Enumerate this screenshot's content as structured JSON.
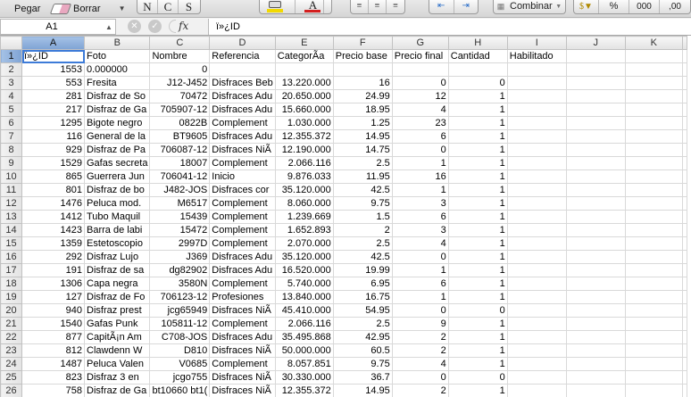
{
  "toolbar": {
    "paste_label": "Pegar",
    "clear_label": "Borrar",
    "bold": "N",
    "italic": "C",
    "underline": "S",
    "merge_label": "Combinar",
    "percent": "%",
    "thousands": "000",
    "decimals": ",00",
    "icon_font_color": "#d42020",
    "icon_fill_color": "#f2d900"
  },
  "formula_bar": {
    "cell_ref": "A1",
    "fx": "fx",
    "content": "ï»¿ID"
  },
  "columns": [
    "A",
    "B",
    "C",
    "D",
    "E",
    "F",
    "G",
    "H",
    "I",
    "J",
    "K"
  ],
  "rows": [
    {
      "n": "1",
      "cells": [
        "ï»¿ID",
        "Foto",
        "Nombre",
        "Referencia",
        "CategorÃ­a",
        "Precio base",
        "Precio final",
        "Cantidad",
        "Habilitado",
        "",
        ""
      ]
    },
    {
      "n": "2",
      "cells": [
        "1553",
        "0.000000",
        "0",
        "",
        "",
        "",
        "",
        "",
        "",
        "",
        ""
      ]
    },
    {
      "n": "3",
      "cells": [
        "553",
        "Fresita",
        "J12-J452",
        "Disfraces Beb",
        "13.220.000",
        "16",
        "0",
        "0",
        "",
        "",
        ""
      ]
    },
    {
      "n": "4",
      "cells": [
        "281",
        "Disfraz de So",
        "70472",
        "Disfraces Adu",
        "20.650.000",
        "24.99",
        "12",
        "1",
        "",
        "",
        ""
      ]
    },
    {
      "n": "5",
      "cells": [
        "217",
        "Disfraz de Ga",
        "705907-12",
        "Disfraces Adu",
        "15.660.000",
        "18.95",
        "4",
        "1",
        "",
        "",
        ""
      ]
    },
    {
      "n": "6",
      "cells": [
        "1295",
        "Bigote negro",
        "0822B",
        "Complement",
        "1.030.000",
        "1.25",
        "23",
        "1",
        "",
        "",
        ""
      ]
    },
    {
      "n": "7",
      "cells": [
        "116",
        "General de la",
        "BT9605",
        "Disfraces Adu",
        "12.355.372",
        "14.95",
        "6",
        "1",
        "",
        "",
        ""
      ]
    },
    {
      "n": "8",
      "cells": [
        "929",
        "Disfraz de Pa",
        "706087-12",
        "Disfraces NiÃ",
        "12.190.000",
        "14.75",
        "0",
        "1",
        "",
        "",
        ""
      ]
    },
    {
      "n": "9",
      "cells": [
        "1529",
        "Gafas secreta",
        "18007",
        "Complement",
        "2.066.116",
        "2.5",
        "1",
        "1",
        "",
        "",
        ""
      ]
    },
    {
      "n": "10",
      "cells": [
        "865",
        "Guerrera Jun",
        "706041-12",
        "Inicio",
        "9.876.033",
        "11.95",
        "16",
        "1",
        "",
        "",
        ""
      ]
    },
    {
      "n": "11",
      "cells": [
        "801",
        "Disfraz de bo",
        "J482-JOS",
        "Disfraces cor",
        "35.120.000",
        "42.5",
        "1",
        "1",
        "",
        "",
        ""
      ]
    },
    {
      "n": "12",
      "cells": [
        "1476",
        "Peluca mod.",
        "M6517",
        "Complement",
        "8.060.000",
        "9.75",
        "3",
        "1",
        "",
        "",
        ""
      ]
    },
    {
      "n": "13",
      "cells": [
        "1412",
        "Tubo Maquil",
        "15439",
        "Complement",
        "1.239.669",
        "1.5",
        "6",
        "1",
        "",
        "",
        ""
      ]
    },
    {
      "n": "14",
      "cells": [
        "1423",
        "Barra de labi",
        "15472",
        "Complement",
        "1.652.893",
        "2",
        "3",
        "1",
        "",
        "",
        ""
      ]
    },
    {
      "n": "15",
      "cells": [
        "1359",
        "Estetoscopio",
        "2997D",
        "Complement",
        "2.070.000",
        "2.5",
        "4",
        "1",
        "",
        "",
        ""
      ]
    },
    {
      "n": "16",
      "cells": [
        "292",
        "Disfraz Lujo",
        "J369",
        "Disfraces Adu",
        "35.120.000",
        "42.5",
        "0",
        "1",
        "",
        "",
        ""
      ]
    },
    {
      "n": "17",
      "cells": [
        "191",
        "Disfraz de sa",
        "dg82902",
        "Disfraces Adu",
        "16.520.000",
        "19.99",
        "1",
        "1",
        "",
        "",
        ""
      ]
    },
    {
      "n": "18",
      "cells": [
        "1306",
        "Capa negra",
        "3580N",
        "Complement",
        "5.740.000",
        "6.95",
        "6",
        "1",
        "",
        "",
        ""
      ]
    },
    {
      "n": "19",
      "cells": [
        "127",
        "Disfraz de Fo",
        "706123-12",
        "Profesiones",
        "13.840.000",
        "16.75",
        "1",
        "1",
        "",
        "",
        ""
      ]
    },
    {
      "n": "20",
      "cells": [
        "940",
        "Disfraz prest",
        "jcg65949",
        "Disfraces NiÃ",
        "45.410.000",
        "54.95",
        "0",
        "0",
        "",
        "",
        ""
      ]
    },
    {
      "n": "21",
      "cells": [
        "1540",
        "Gafas Punk",
        "105811-12",
        "Complement",
        "2.066.116",
        "2.5",
        "9",
        "1",
        "",
        "",
        ""
      ]
    },
    {
      "n": "22",
      "cells": [
        "877",
        "CapitÃ¡n Am",
        "C708-JOS",
        "Disfraces Adu",
        "35.495.868",
        "42.95",
        "2",
        "1",
        "",
        "",
        ""
      ]
    },
    {
      "n": "23",
      "cells": [
        "812",
        "Clawdenn W",
        "D810",
        "Disfraces NiÃ",
        "50.000.000",
        "60.5",
        "2",
        "1",
        "",
        "",
        ""
      ]
    },
    {
      "n": "24",
      "cells": [
        "1487",
        "Peluca Valen",
        "V0685",
        "Complement",
        "8.057.851",
        "9.75",
        "4",
        "1",
        "",
        "",
        ""
      ]
    },
    {
      "n": "25",
      "cells": [
        "823",
        "Disfraz 3 en",
        "jcgo755",
        "Disfraces NiÃ",
        "30.330.000",
        "36.7",
        "0",
        "0",
        "",
        "",
        ""
      ]
    },
    {
      "n": "26",
      "cells": [
        "758",
        "Disfraz de Ga",
        "bt10660 bt1(",
        "Disfraces NiÃ",
        "12.355.372",
        "14.95",
        "2",
        "1",
        "",
        "",
        ""
      ]
    }
  ]
}
